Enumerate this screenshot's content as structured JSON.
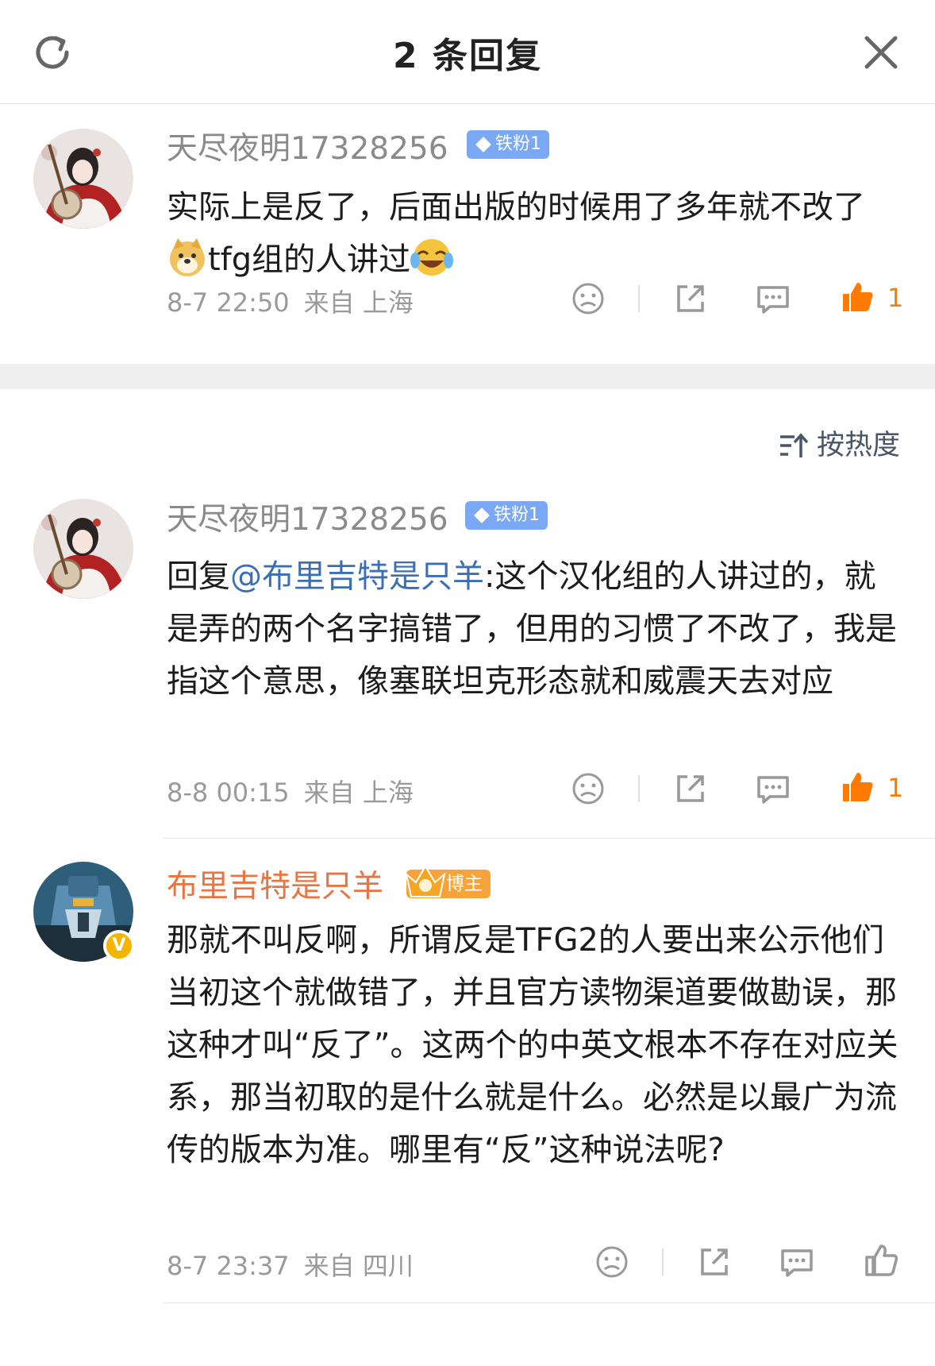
{
  "header": {
    "title": "2 条回复",
    "refresh_icon": "refresh-icon",
    "close_icon": "close-icon"
  },
  "comments": [
    {
      "username": "天尽夜明17328256",
      "badge": "铁粉1",
      "text_before": "实际上是反了，后面出版的时候用了多年就不改了",
      "text_middle": "tfg组的人讲过",
      "date": "8-7 22:50",
      "source": "来自 上海",
      "like_count": "1",
      "liked": true
    }
  ],
  "sort": {
    "label": "按热度"
  },
  "replies": [
    {
      "username": "天尽夜明17328256",
      "badge": "铁粉1",
      "reply_prefix": "回复",
      "mention": "@布里吉特是只羊",
      "text": ":这个汉化组的人讲过的，就是弄的两个名字搞错了，但用的习惯了不改了，我是指这个意思，像塞联坦克形态就和威震天去对应",
      "date": "8-8 00:15",
      "source": "来自 上海",
      "like_count": "1",
      "liked": true
    },
    {
      "username": "布里吉特是只羊",
      "badge": "博主",
      "verified_mark": "V",
      "text": "那就不叫反啊，所谓反是TFG2的人要出来公示他们当初这个就做错了，并且官方读物渠道要做勘误，那这种才叫“反了”。这两个的中英文根本不存在对应关系，那当初取的是什么就是什么。必然是以最广为流传的版本为准。哪里有“反”这种说法呢?",
      "date": "8-7 23:37",
      "source": "来自 四川",
      "like_count": "",
      "liked": false
    }
  ],
  "colors": {
    "like_active": "#ff7a00",
    "author_name": "#eb7340",
    "mention": "#3b6fb5",
    "fan_badge": "#7aa8f4",
    "bozhu_badge": "#f7a33a"
  },
  "icons": [
    "refresh-icon",
    "close-icon",
    "dislike-icon",
    "share-icon",
    "comment-icon",
    "like-icon",
    "sort-icon",
    "doge-emoji",
    "laugh-cry-emoji",
    "crown-icon"
  ]
}
